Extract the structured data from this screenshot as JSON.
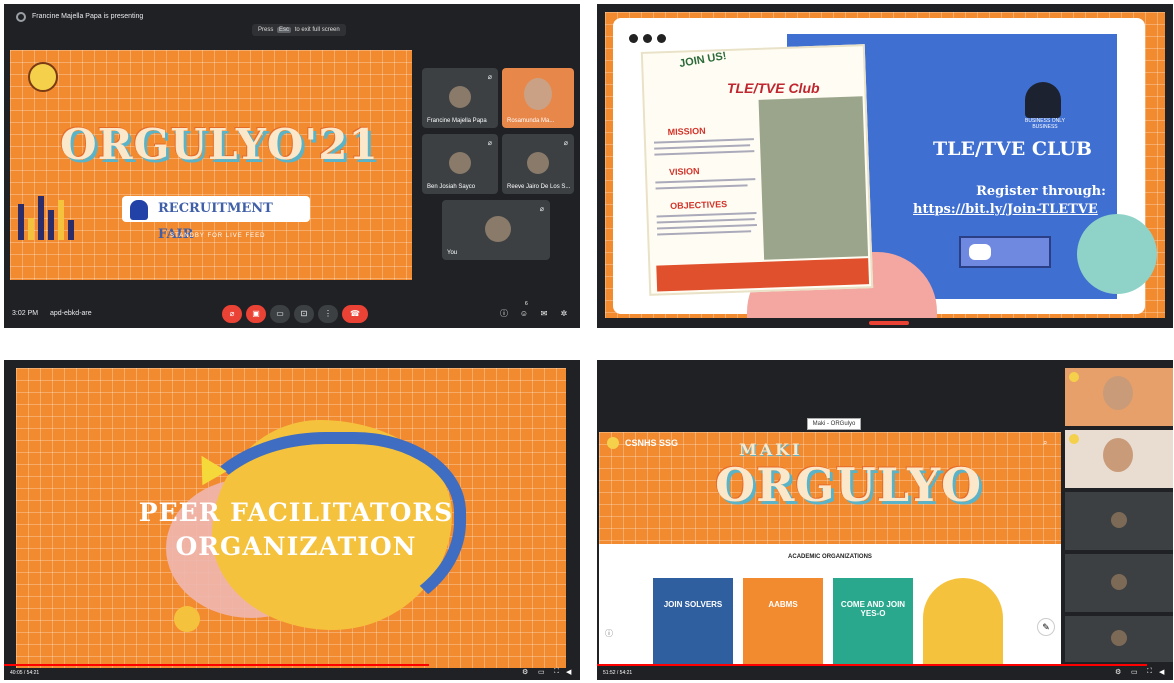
{
  "panel1": {
    "presenting_text": "Francine Majella Papa is presenting",
    "exit_hint": {
      "pre": "Press",
      "key": "Esc",
      "post": "to exit full screen"
    },
    "slide_title": "ORGULYO'21",
    "slide_badge": "RECRUITMENT FAIR",
    "slide_subtitle": "STANDBY FOR LIVE FEED",
    "participants": [
      {
        "name": "Francine Majella Papa"
      },
      {
        "name": "Rosamunda Ma..."
      },
      {
        "name": "Ben Josiah Sayco"
      },
      {
        "name": "Reeve Jairo De Los S..."
      },
      {
        "name": "You"
      }
    ],
    "clock": "3:02 PM",
    "meeting_code": "apd-ebkd-are",
    "participant_count": "6"
  },
  "panel2": {
    "poster_join": "JOIN US!",
    "poster_title": "TLE/TVE Club",
    "poster_sections": [
      "MISSION",
      "VISION",
      "OBJECTIVES"
    ],
    "club_name": "TLE/TVE CLUB",
    "register_label": "Register through:",
    "register_link": "https://bit.ly/Join-TLETVE",
    "business_caption": "BUSINESS ONLY BUSINESS"
  },
  "panel3": {
    "org_line1": "PEER FACILITATORS",
    "org_line2": "ORGANIZATION",
    "video_time": "40:05 / 54:21",
    "progress": 0.737
  },
  "panel4": {
    "tab_label": "Maki - ORGulyo",
    "site_name": "CSNHS SSG",
    "hero_small": "MAKI",
    "hero_big": "ORGULYO",
    "section_title": "ACADEMIC ORGANIZATIONS",
    "cards": [
      {
        "label": "JOIN SOLVERS",
        "color": "#2f5f9e"
      },
      {
        "label": "AABMS",
        "color": "#f28a2f"
      },
      {
        "label": "COME AND JOIN YES-O",
        "color": "#2aa88e"
      },
      {
        "label": "",
        "color": "#f5c23d"
      }
    ],
    "video_time": "51:52 / 54:21",
    "progress": 0.955
  },
  "colors": {
    "accent": "#f28a2f",
    "meet_dark": "#202124",
    "end_call": "#ea4335"
  }
}
